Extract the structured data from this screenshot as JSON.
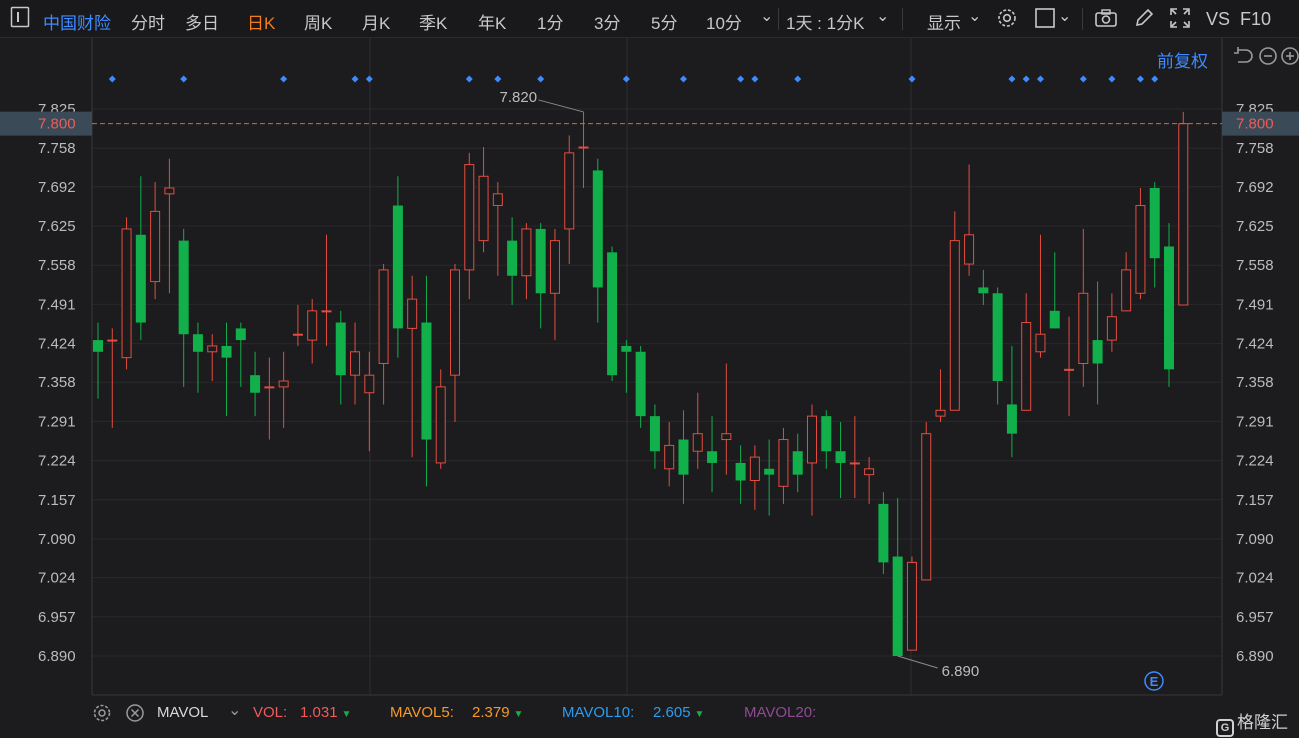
{
  "toolbar": {
    "name": "中国财险",
    "tabs": [
      "分时",
      "多日",
      "日K",
      "周K",
      "月K",
      "季K",
      "年K",
      "1分",
      "3分",
      "5分",
      "10分"
    ],
    "active_tab": "日K",
    "period_select": "1天 : 1分K",
    "display_label": "显示",
    "vs_label": "VS",
    "f10_label": "F10"
  },
  "fq_label": "前复权",
  "colors": {
    "up": "#e34d3f",
    "down": "#11b04b",
    "accent": "#3e8bff",
    "active_tab": "#f07d1f",
    "current_price_line": "#e8642e",
    "vol": "#f25a5a",
    "mavol5": "#f59a2b",
    "mavol10": "#2d9cf0",
    "mavol20": "#8e4b93"
  },
  "indicator": {
    "name": "MAVOL",
    "vol_label": "VOL:",
    "vol_value": "1.031",
    "mavol5_label": "MAVOL5:",
    "mavol5_value": "2.379",
    "mavol10_label": "MAVOL10:",
    "mavol10_value": "2.605",
    "mavol20_label": "MAVOL20:"
  },
  "watermark": "格隆汇",
  "chart_data": {
    "type": "candlestick",
    "y_ticks": [
      "7.825",
      "7.758",
      "7.692",
      "7.625",
      "7.558",
      "7.491",
      "7.424",
      "7.358",
      "7.291",
      "7.224",
      "7.157",
      "7.090",
      "7.024",
      "6.957",
      "6.890"
    ],
    "ylim": [
      6.85,
      7.85
    ],
    "current_price": "7.800",
    "max_label": "7.820",
    "min_label": "6.890",
    "event_marker_label": "E",
    "grid": true,
    "candles": [
      {
        "o": 7.43,
        "c": 7.41,
        "h": 7.46,
        "l": 7.33
      },
      {
        "o": 7.43,
        "c": 7.43,
        "h": 7.45,
        "l": 7.28
      },
      {
        "o": 7.4,
        "c": 7.62,
        "h": 7.64,
        "l": 7.38
      },
      {
        "o": 7.61,
        "c": 7.46,
        "h": 7.71,
        "l": 7.43
      },
      {
        "o": 7.53,
        "c": 7.65,
        "h": 7.7,
        "l": 7.5
      },
      {
        "o": 7.68,
        "c": 7.69,
        "h": 7.74,
        "l": 7.51
      },
      {
        "o": 7.6,
        "c": 7.44,
        "h": 7.62,
        "l": 7.35
      },
      {
        "o": 7.44,
        "c": 7.41,
        "h": 7.46,
        "l": 7.34
      },
      {
        "o": 7.41,
        "c": 7.42,
        "h": 7.44,
        "l": 7.36
      },
      {
        "o": 7.42,
        "c": 7.4,
        "h": 7.46,
        "l": 7.3
      },
      {
        "o": 7.45,
        "c": 7.43,
        "h": 7.46,
        "l": 7.35
      },
      {
        "o": 7.37,
        "c": 7.34,
        "h": 7.41,
        "l": 7.3
      },
      {
        "o": 7.35,
        "c": 7.35,
        "h": 7.4,
        "l": 7.26
      },
      {
        "o": 7.35,
        "c": 7.36,
        "h": 7.41,
        "l": 7.28
      },
      {
        "o": 7.44,
        "c": 7.44,
        "h": 7.49,
        "l": 7.42
      },
      {
        "o": 7.43,
        "c": 7.48,
        "h": 7.5,
        "l": 7.39
      },
      {
        "o": 7.48,
        "c": 7.48,
        "h": 7.61,
        "l": 7.42
      },
      {
        "o": 7.46,
        "c": 7.37,
        "h": 7.48,
        "l": 7.32
      },
      {
        "o": 7.37,
        "c": 7.41,
        "h": 7.46,
        "l": 7.32
      },
      {
        "o": 7.34,
        "c": 7.37,
        "h": 7.41,
        "l": 7.24
      },
      {
        "o": 7.39,
        "c": 7.55,
        "h": 7.56,
        "l": 7.32
      },
      {
        "o": 7.66,
        "c": 7.45,
        "h": 7.71,
        "l": 7.4
      },
      {
        "o": 7.45,
        "c": 7.5,
        "h": 7.54,
        "l": 7.23
      },
      {
        "o": 7.46,
        "c": 7.26,
        "h": 7.54,
        "l": 7.18
      },
      {
        "o": 7.22,
        "c": 7.35,
        "h": 7.38,
        "l": 7.21
      },
      {
        "o": 7.37,
        "c": 7.55,
        "h": 7.56,
        "l": 7.29
      },
      {
        "o": 7.55,
        "c": 7.73,
        "h": 7.75,
        "l": 7.5
      },
      {
        "o": 7.6,
        "c": 7.71,
        "h": 7.76,
        "l": 7.58
      },
      {
        "o": 7.66,
        "c": 7.68,
        "h": 7.7,
        "l": 7.54
      },
      {
        "o": 7.6,
        "c": 7.54,
        "h": 7.64,
        "l": 7.49
      },
      {
        "o": 7.54,
        "c": 7.62,
        "h": 7.63,
        "l": 7.5
      },
      {
        "o": 7.62,
        "c": 7.51,
        "h": 7.63,
        "l": 7.45
      },
      {
        "o": 7.51,
        "c": 7.6,
        "h": 7.62,
        "l": 7.43
      },
      {
        "o": 7.62,
        "c": 7.75,
        "h": 7.78,
        "l": 7.56
      },
      {
        "o": 7.76,
        "c": 7.76,
        "h": 7.82,
        "l": 7.69
      },
      {
        "o": 7.72,
        "c": 7.52,
        "h": 7.74,
        "l": 7.46
      },
      {
        "o": 7.58,
        "c": 7.37,
        "h": 7.59,
        "l": 7.36
      },
      {
        "o": 7.42,
        "c": 7.41,
        "h": 7.43,
        "l": 7.34
      },
      {
        "o": 7.41,
        "c": 7.3,
        "h": 7.42,
        "l": 7.28
      },
      {
        "o": 7.3,
        "c": 7.24,
        "h": 7.32,
        "l": 7.21
      },
      {
        "o": 7.21,
        "c": 7.25,
        "h": 7.29,
        "l": 7.18
      },
      {
        "o": 7.26,
        "c": 7.2,
        "h": 7.31,
        "l": 7.15
      },
      {
        "o": 7.24,
        "c": 7.27,
        "h": 7.34,
        "l": 7.21
      },
      {
        "o": 7.24,
        "c": 7.22,
        "h": 7.3,
        "l": 7.17
      },
      {
        "o": 7.26,
        "c": 7.27,
        "h": 7.39,
        "l": 7.2
      },
      {
        "o": 7.22,
        "c": 7.19,
        "h": 7.25,
        "l": 7.15
      },
      {
        "o": 7.19,
        "c": 7.23,
        "h": 7.25,
        "l": 7.14
      },
      {
        "o": 7.21,
        "c": 7.2,
        "h": 7.26,
        "l": 7.13
      },
      {
        "o": 7.18,
        "c": 7.26,
        "h": 7.28,
        "l": 7.15
      },
      {
        "o": 7.24,
        "c": 7.2,
        "h": 7.27,
        "l": 7.17
      },
      {
        "o": 7.22,
        "c": 7.3,
        "h": 7.32,
        "l": 7.13
      },
      {
        "o": 7.3,
        "c": 7.24,
        "h": 7.31,
        "l": 7.21
      },
      {
        "o": 7.24,
        "c": 7.22,
        "h": 7.29,
        "l": 7.16
      },
      {
        "o": 7.22,
        "c": 7.22,
        "h": 7.3,
        "l": 7.16
      },
      {
        "o": 7.2,
        "c": 7.21,
        "h": 7.23,
        "l": 7.15
      },
      {
        "o": 7.15,
        "c": 7.05,
        "h": 7.17,
        "l": 7.03
      },
      {
        "o": 7.06,
        "c": 6.89,
        "h": 7.16,
        "l": 6.89
      },
      {
        "o": 6.9,
        "c": 7.05,
        "h": 7.06,
        "l": 6.9
      },
      {
        "o": 7.02,
        "c": 7.27,
        "h": 7.29,
        "l": 7.02
      },
      {
        "o": 7.3,
        "c": 7.31,
        "h": 7.38,
        "l": 7.29
      },
      {
        "o": 7.31,
        "c": 7.6,
        "h": 7.65,
        "l": 7.31
      },
      {
        "o": 7.56,
        "c": 7.61,
        "h": 7.73,
        "l": 7.54
      },
      {
        "o": 7.52,
        "c": 7.51,
        "h": 7.55,
        "l": 7.49
      },
      {
        "o": 7.51,
        "c": 7.36,
        "h": 7.52,
        "l": 7.32
      },
      {
        "o": 7.32,
        "c": 7.27,
        "h": 7.42,
        "l": 7.23
      },
      {
        "o": 7.31,
        "c": 7.46,
        "h": 7.51,
        "l": 7.31
      },
      {
        "o": 7.41,
        "c": 7.44,
        "h": 7.61,
        "l": 7.4
      },
      {
        "o": 7.48,
        "c": 7.45,
        "h": 7.58,
        "l": 7.45
      },
      {
        "o": 7.38,
        "c": 7.38,
        "h": 7.47,
        "l": 7.3
      },
      {
        "o": 7.39,
        "c": 7.51,
        "h": 7.62,
        "l": 7.35
      },
      {
        "o": 7.43,
        "c": 7.39,
        "h": 7.53,
        "l": 7.32
      },
      {
        "o": 7.43,
        "c": 7.47,
        "h": 7.51,
        "l": 7.41
      },
      {
        "o": 7.48,
        "c": 7.55,
        "h": 7.58,
        "l": 7.48
      },
      {
        "o": 7.51,
        "c": 7.66,
        "h": 7.69,
        "l": 7.5
      },
      {
        "o": 7.69,
        "c": 7.57,
        "h": 7.7,
        "l": 7.52
      },
      {
        "o": 7.59,
        "c": 7.38,
        "h": 7.63,
        "l": 7.35
      },
      {
        "o": 7.49,
        "c": 7.8,
        "h": 7.82,
        "l": 7.49
      }
    ],
    "x_markers": [
      1,
      6,
      13,
      18,
      19,
      26,
      28,
      31,
      37,
      41,
      45,
      46,
      49,
      57,
      64,
      65,
      66,
      69,
      71,
      73,
      74
    ]
  }
}
